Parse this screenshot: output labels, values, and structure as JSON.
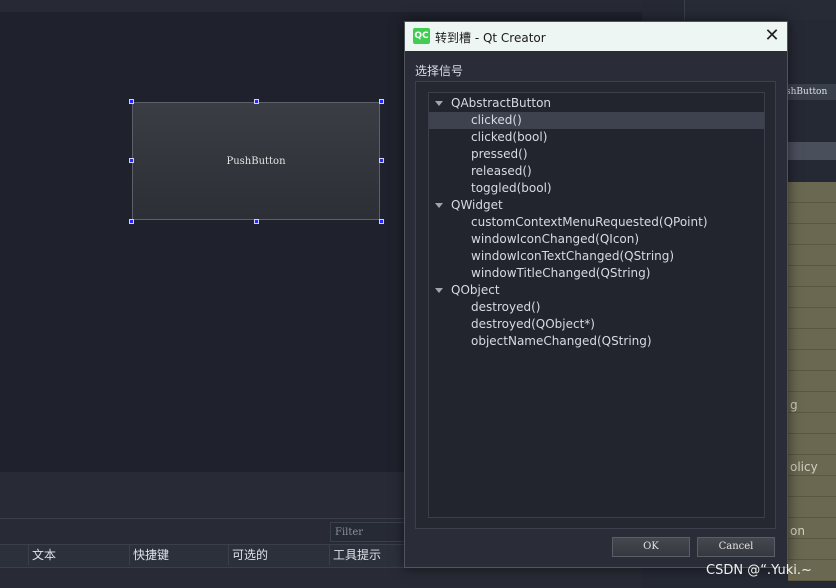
{
  "canvas": {
    "pushbutton_label": "PushButton"
  },
  "right_panel": {
    "header_fragment": "shButton",
    "fragments": [
      "g",
      "olicy",
      "on"
    ]
  },
  "action_editor": {
    "filter_placeholder": "Filter",
    "columns": [
      "文本",
      "快捷键",
      "可选的",
      "工具提示"
    ]
  },
  "dialog": {
    "title": "转到槽 - Qt Creator",
    "logo_text": "QC",
    "close_icon": "close-icon",
    "group_label": "选择信号",
    "tree": [
      {
        "label": "QAbstractButton",
        "level": 0,
        "expanded": true
      },
      {
        "label": "clicked()",
        "level": 1,
        "selected": true
      },
      {
        "label": "clicked(bool)",
        "level": 1
      },
      {
        "label": "pressed()",
        "level": 1
      },
      {
        "label": "released()",
        "level": 1
      },
      {
        "label": "toggled(bool)",
        "level": 1
      },
      {
        "label": "QWidget",
        "level": 0,
        "expanded": true
      },
      {
        "label": "customContextMenuRequested(QPoint)",
        "level": 1
      },
      {
        "label": "windowIconChanged(QIcon)",
        "level": 1
      },
      {
        "label": "windowIconTextChanged(QString)",
        "level": 1
      },
      {
        "label": "windowTitleChanged(QString)",
        "level": 1
      },
      {
        "label": "QObject",
        "level": 0,
        "expanded": true
      },
      {
        "label": "destroyed()",
        "level": 1
      },
      {
        "label": "destroyed(QObject*)",
        "level": 1
      },
      {
        "label": "objectNameChanged(QString)",
        "level": 1
      }
    ],
    "ok_label": "OK",
    "cancel_label": "Cancel"
  },
  "watermark": "CSDN @“.Yuki.~"
}
